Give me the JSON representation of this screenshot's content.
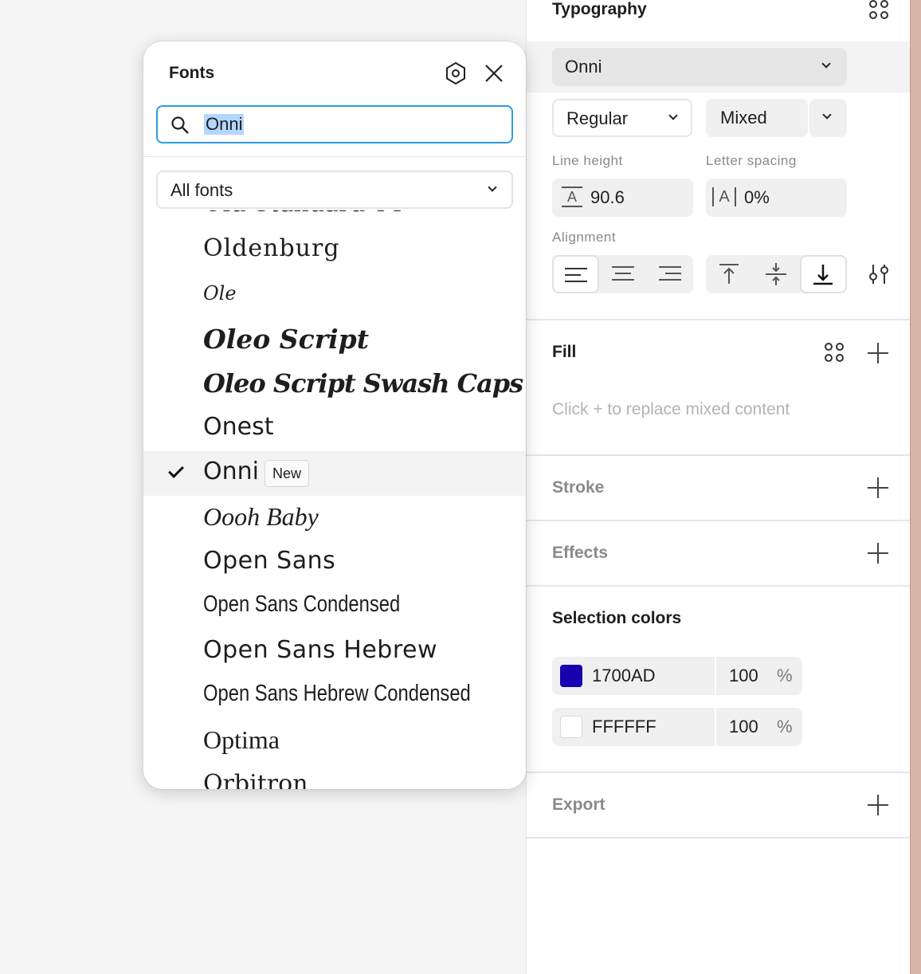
{
  "typography": {
    "title": "Typography",
    "font_family": "Onni",
    "font_style": "Regular",
    "font_size": "Mixed",
    "line_height_label": "Line height",
    "line_height_value": "90.6",
    "letter_spacing_label": "Letter spacing",
    "letter_spacing_value": "0%",
    "alignment_label": "Alignment"
  },
  "fill": {
    "title": "Fill",
    "placeholder": "Click + to replace mixed content"
  },
  "stroke": {
    "title": "Stroke"
  },
  "effects": {
    "title": "Effects"
  },
  "selection_colors": {
    "title": "Selection colors",
    "colors": [
      {
        "hex": "1700AD",
        "opacity": "100",
        "unit": "%",
        "swatch": "#1700AD"
      },
      {
        "hex": "FFFFFF",
        "opacity": "100",
        "unit": "%",
        "swatch": "#FFFFFF"
      }
    ]
  },
  "export": {
    "title": "Export"
  },
  "font_picker": {
    "title": "Fonts",
    "search_value": "Onni",
    "filter": "All fonts",
    "new_badge": "New",
    "fonts": [
      {
        "name": "Old Standard TT"
      },
      {
        "name": "Oldenburg"
      },
      {
        "name": "Ole"
      },
      {
        "name": "Oleo Script"
      },
      {
        "name": "Oleo Script Swash Caps"
      },
      {
        "name": "Onest"
      },
      {
        "name": "Onni"
      },
      {
        "name": "Oooh Baby"
      },
      {
        "name": "Open Sans"
      },
      {
        "name": "Open Sans Condensed"
      },
      {
        "name": "Open Sans Hebrew"
      },
      {
        "name": "Open Sans Hebrew Condensed"
      },
      {
        "name": "Optima"
      },
      {
        "name": "Orbitron"
      }
    ],
    "selected_index": 6
  },
  "colors": {
    "accent": "#2e9be0",
    "selection_highlight": "#b4d7ff"
  }
}
